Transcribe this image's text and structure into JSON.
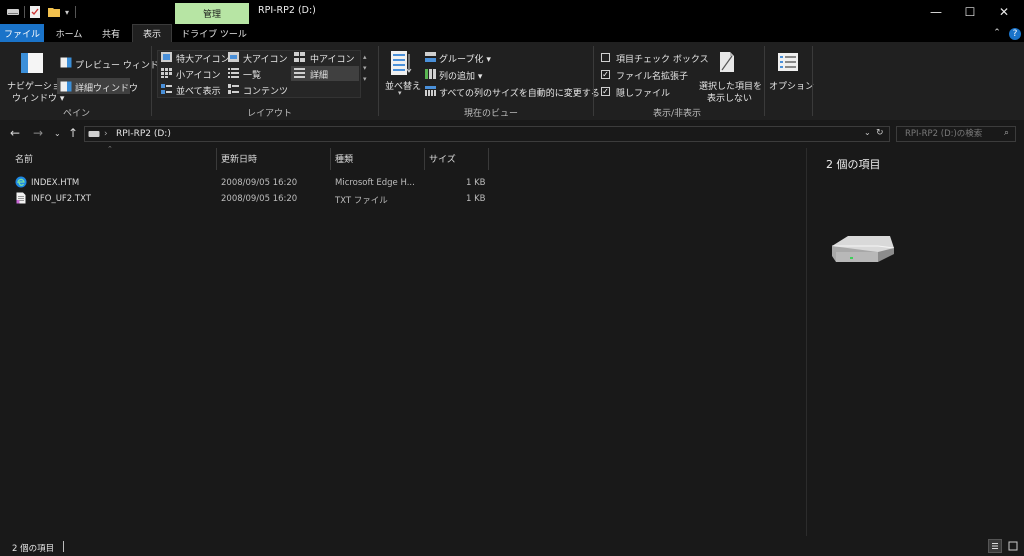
{
  "titlebar": {
    "context_tab": "管理",
    "title": "RPI-RP2 (D:)",
    "minimize": "—",
    "maximize": "☐",
    "close": "✕"
  },
  "tabs": {
    "file": "ファイル",
    "home": "ホーム",
    "share": "共有",
    "view": "表示",
    "drive_tools": "ドライブ ツール",
    "collapse": "⌃",
    "help": "?"
  },
  "ribbon": {
    "pane": {
      "nav_pane_line1": "ナビゲーション",
      "nav_pane_line2": "ウィンドウ",
      "preview_pane": "プレビュー ウィンドウ",
      "details_pane": "詳細ウィンドウ",
      "group_label": "ペイン"
    },
    "layout": {
      "extra_large": "特大アイコン",
      "large": "大アイコン",
      "medium": "中アイコン",
      "small": "小アイコン",
      "list": "一覧",
      "details": "詳細",
      "tiles": "並べて表示",
      "content": "コンテンツ",
      "group_label": "レイアウト"
    },
    "current_view": {
      "sort_line1": "並べ替え",
      "group_by": "グループ化",
      "add_columns": "列の追加",
      "fit_columns": "すべての列のサイズを自動的に変更する",
      "group_label": "現在のビュー"
    },
    "show_hide": {
      "item_checkboxes": "項目チェック ボックス",
      "extensions": "ファイル名拡張子",
      "hidden_items": "隠しファイル",
      "hide_selected_line1": "選択した項目を",
      "hide_selected_line2": "表示しない",
      "group_label": "表示/非表示"
    },
    "options": "オプション"
  },
  "address": {
    "path": "RPI-RP2 (D:)",
    "search_placeholder": "RPI-RP2 (D:)の検索"
  },
  "columns": {
    "name": "名前",
    "modified": "更新日時",
    "type": "種類",
    "size": "サイズ"
  },
  "files": [
    {
      "name": "INDEX.HTM",
      "modified": "2008/09/05 16:20",
      "type": "Microsoft Edge H...",
      "size": "1 KB",
      "icon": "edge-icon"
    },
    {
      "name": "INFO_UF2.TXT",
      "modified": "2008/09/05 16:20",
      "type": "TXT ファイル",
      "size": "1 KB",
      "icon": "text-file-icon"
    }
  ],
  "preview": {
    "item_count": "2 個の項目"
  },
  "status": {
    "item_count": "2 個の項目"
  },
  "colors": {
    "file_tab": "#1a73c9",
    "context_tab": "#b7e5a4",
    "ribbon_bg": "#202020",
    "body_bg": "#191919"
  }
}
